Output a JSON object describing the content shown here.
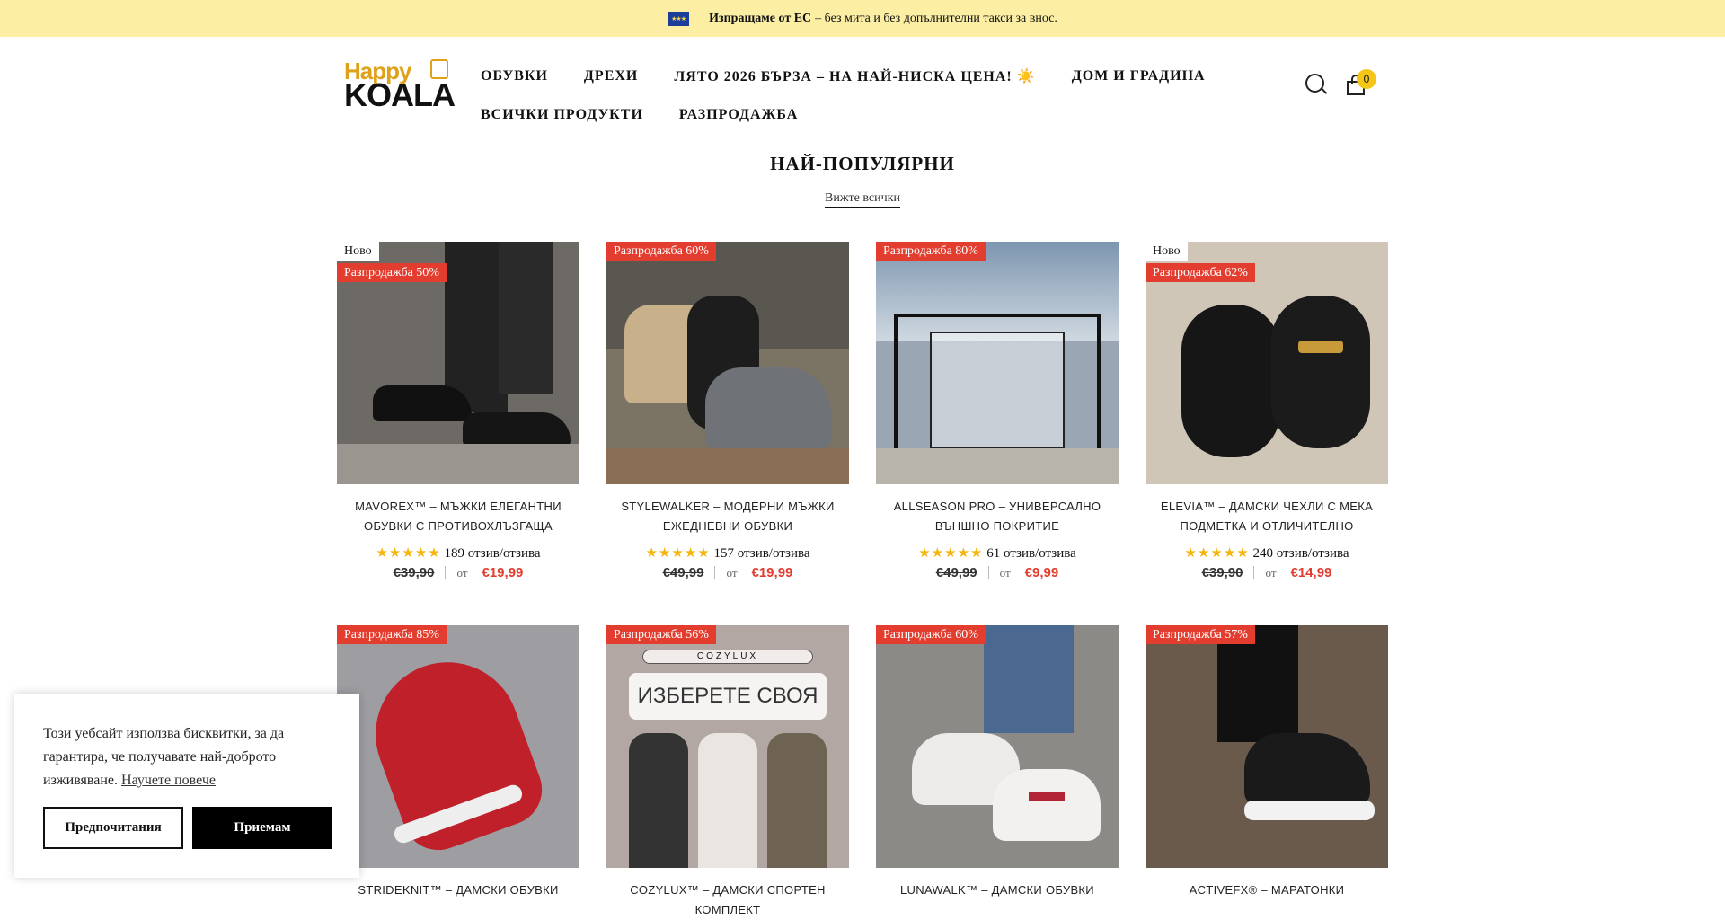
{
  "topbar": {
    "bold": "Изпращаме от ЕС",
    "text": "– без мита и без допълнителни такси за внос."
  },
  "logo": {
    "line1": "Happy",
    "line2": "KOALA"
  },
  "nav": {
    "row1": [
      "ОБУВКИ",
      "ДРЕХИ",
      "ЛЯТО 2026 БЪРЗА – НА НАЙ-НИСКА ЦЕНА! ☀️",
      "ДОМ И ГРАДИНА"
    ],
    "row2": [
      "ВСИЧКИ ПРОДУКТИ",
      "РАЗПРОДАЖБА"
    ]
  },
  "cart": {
    "count": "0"
  },
  "section": {
    "title": "НАЙ-ПОПУЛЯРНИ",
    "view_all": "Вижте всички"
  },
  "products": [
    {
      "new_tag": "Ново",
      "sale_tag": "Разпродажба 50%",
      "title": "MAVOREX™ – МЪЖКИ ЕЛЕГАНТНИ ОБУВКИ С ПРОТИВОХЛЪЗГАЩА ПОДМЕТКА",
      "stars": "★★★★★",
      "reviews": "189 отзив/отзива",
      "old_price": "€39,90",
      "from": "от",
      "price": "€19,99",
      "img_color": "#6d6a66"
    },
    {
      "new_tag": "",
      "sale_tag": "Разпродажба 60%",
      "title": "STYLEWALKER – МОДЕРНИ МЪЖКИ ЕЖЕДНЕВНИ ОБУВКИ",
      "stars": "★★★★★",
      "reviews": "157 отзив/отзива",
      "old_price": "€49,99",
      "from": "от",
      "price": "€19,99",
      "img_color": "#7b7363"
    },
    {
      "new_tag": "",
      "sale_tag": "Разпродажба 80%",
      "title": "ALLSEASON PRO – УНИВЕРСАЛНО ВЪНШНО ПОКРИТИЕ",
      "stars": "★★★★★",
      "reviews": "61 отзив/отзива",
      "old_price": "€49,99",
      "from": "от",
      "price": "€9,99",
      "img_color": "#9aa6b3"
    },
    {
      "new_tag": "Ново",
      "sale_tag": "Разпродажба 62%",
      "title": "ELEVIA™ – ДАМСКИ ЧЕХЛИ С МЕКА ПОДМЕТКА И ОТЛИЧИТЕЛНО ПОДОБРЕНИЕ…",
      "stars": "★★★★★",
      "reviews": "240 отзив/отзива",
      "old_price": "€39,90",
      "from": "от",
      "price": "€14,99",
      "img_color": "#cfc6b8"
    },
    {
      "new_tag": "",
      "sale_tag": "Разпродажба 85%",
      "title": "STRIDEKNIT™ – ДАМСКИ ОБУВКИ",
      "stars": "",
      "reviews": "",
      "old_price": "",
      "from": "",
      "price": "",
      "img_color": "#9d9da2"
    },
    {
      "new_tag": "",
      "sale_tag": "Разпродажба 56%",
      "title": "COZYLUX™ – ДАМСКИ СПОРТЕН КОМПЛЕКТ",
      "stars": "",
      "reviews": "",
      "old_price": "",
      "from": "",
      "price": "",
      "img_color": "#b3a7a4"
    },
    {
      "new_tag": "",
      "sale_tag": "Разпродажба 60%",
      "title": "LUNAWALK™ – ДАМСКИ ОБУВКИ",
      "stars": "",
      "reviews": "",
      "old_price": "",
      "from": "",
      "price": "",
      "img_color": "#8b8a86"
    },
    {
      "new_tag": "",
      "sale_tag": "Разпродажба 57%",
      "title": "ACTIVEFX® – МАРАТОНКИ",
      "stars": "",
      "reviews": "",
      "old_price": "",
      "from": "",
      "price": "",
      "img_color": "#6a5a4c"
    }
  ],
  "cozylux_image": {
    "brand": "COZYLUX",
    "heading": "ИЗБЕРЕТЕ СВОЯ"
  },
  "cookie": {
    "text": "Този уебсайт използва бисквитки, за да гарантира, че получавате най-доброто изживяване.",
    "link": "Научете повече",
    "pref_button": "Предпочитания",
    "accept_button": "Приемам"
  }
}
